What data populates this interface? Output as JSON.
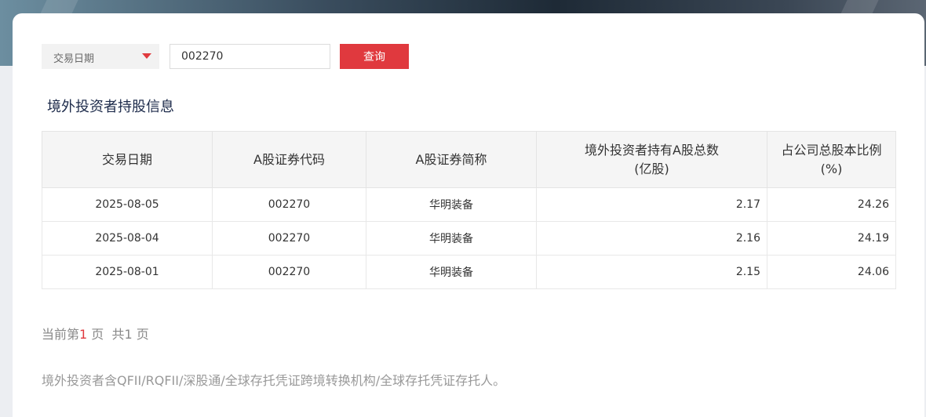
{
  "filter": {
    "select_label": "交易日期",
    "code_value": "002270",
    "query_label": "查询"
  },
  "section_title": "境外投资者持股信息",
  "table": {
    "headers": {
      "date": "交易日期",
      "code": "A股证券代码",
      "name": "A股证券简称",
      "total_line1": "境外投资者持有A股总数",
      "total_line2": "(亿股)",
      "ratio_line1": "占公司总股本比例",
      "ratio_line2": "(%)"
    },
    "rows": [
      {
        "date": "2025-08-05",
        "code": "002270",
        "name": "华明装备",
        "total": "2.17",
        "ratio": "24.26"
      },
      {
        "date": "2025-08-04",
        "code": "002270",
        "name": "华明装备",
        "total": "2.16",
        "ratio": "24.19"
      },
      {
        "date": "2025-08-01",
        "code": "002270",
        "name": "华明装备",
        "total": "2.15",
        "ratio": "24.06"
      }
    ]
  },
  "pager": {
    "prefix": "当前第",
    "current": "1",
    "page_unit": "页",
    "total_prefix": "共1",
    "total_unit": "页"
  },
  "footnote": "境外投资者含QFII/RQFII/深股通/全球存托凭证跨境转换机构/全球存托凭证存托人。",
  "colors": {
    "accent": "#e0393e",
    "title": "#1c2a4a"
  }
}
